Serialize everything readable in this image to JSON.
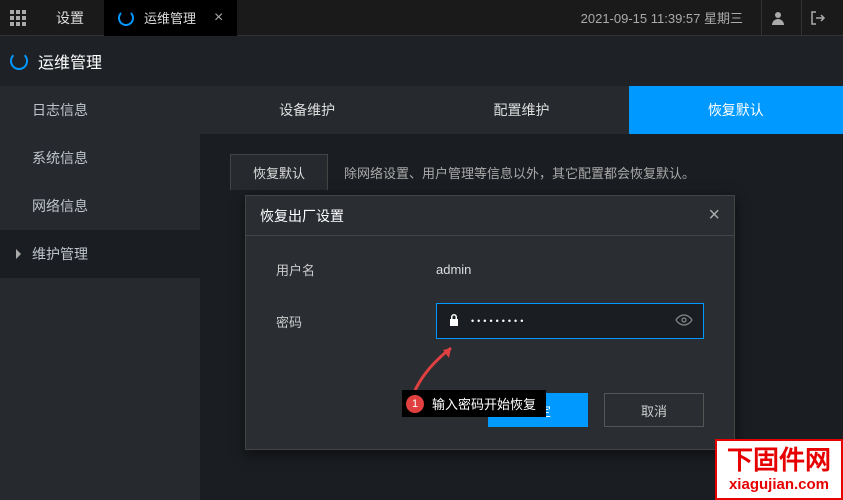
{
  "topbar": {
    "settings": "设置",
    "tab_label": "运维管理",
    "datetime": "2021-09-15 11:39:57 星期三"
  },
  "header": {
    "title": "运维管理"
  },
  "sidebar": {
    "items": [
      {
        "label": "日志信息"
      },
      {
        "label": "系统信息"
      },
      {
        "label": "网络信息"
      },
      {
        "label": "维护管理"
      }
    ]
  },
  "top_tabs": [
    {
      "label": "设备维护"
    },
    {
      "label": "配置维护"
    },
    {
      "label": "恢复默认"
    }
  ],
  "inner": {
    "tab": "恢复默认",
    "note": "除网络设置、用户管理等信息以外，其它配置都会恢复默认。"
  },
  "dialog": {
    "title": "恢复出厂设置",
    "user_label": "用户名",
    "user_value": "admin",
    "pwd_label": "密码",
    "pwd_mask": "•••••••••",
    "ok": "确定",
    "cancel": "取消"
  },
  "annotation": {
    "num": "1",
    "text": "输入密码开始恢复"
  },
  "watermark": {
    "top": "下固件网",
    "bottom": "xiagujian.com"
  }
}
